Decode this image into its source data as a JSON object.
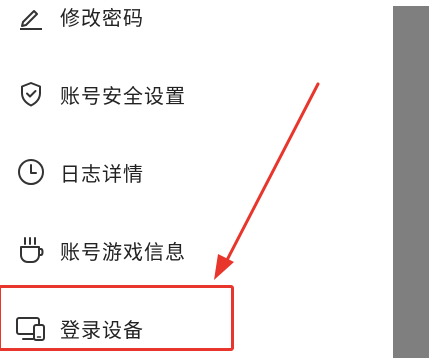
{
  "menu": {
    "items": [
      {
        "id": "change-password",
        "label": "修改密码",
        "icon": "pencil-icon"
      },
      {
        "id": "account-security",
        "label": "账号安全设置",
        "icon": "shield-check-icon"
      },
      {
        "id": "log-details",
        "label": "日志详情",
        "icon": "clock-icon"
      },
      {
        "id": "game-info",
        "label": "账号游戏信息",
        "icon": "cup-icon"
      },
      {
        "id": "login-devices",
        "label": "登录设备",
        "icon": "devices-icon"
      }
    ]
  },
  "annotation": {
    "highlight_color": "#e8362c",
    "highlighted_item": "登录设备"
  },
  "colors": {
    "text": "#222222",
    "side_panel": "#7f7f7f",
    "icon": "#333333"
  }
}
